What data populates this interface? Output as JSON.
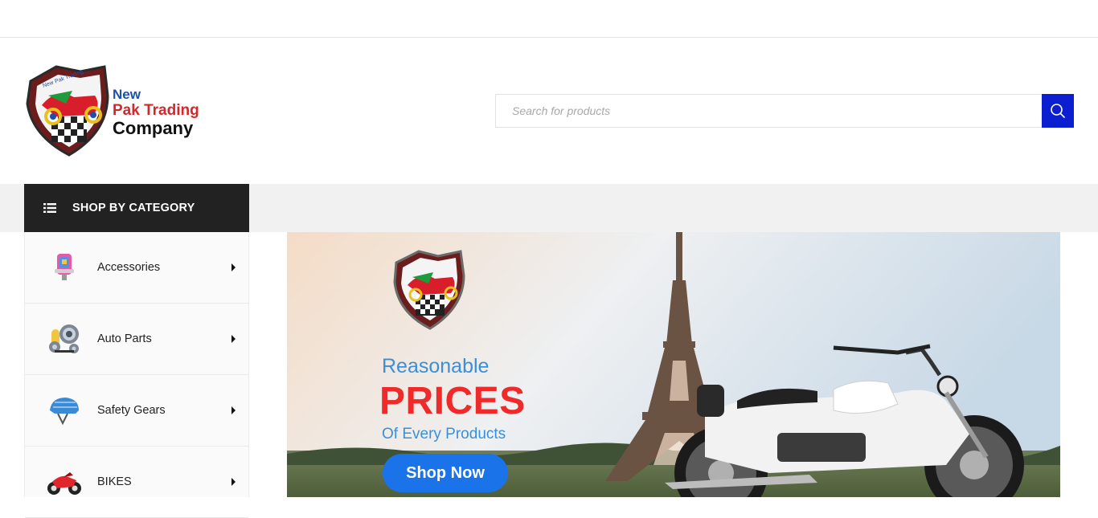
{
  "brand": {
    "line1": "New",
    "line2": "Pak Trading",
    "line3": "Company"
  },
  "search": {
    "placeholder": "Search for products",
    "button_icon": "search-icon"
  },
  "category_menu": {
    "title": "SHOP BY CATEGORY",
    "icon": "list-icon",
    "items": [
      {
        "label": "Accessories",
        "icon": "accessory-icon"
      },
      {
        "label": "Auto Parts",
        "icon": "gears-icon"
      },
      {
        "label": "Safety Gears",
        "icon": "helmet-icon"
      },
      {
        "label": "BIKES",
        "icon": "motorbike-icon"
      }
    ]
  },
  "banner": {
    "line1": "Reasonable",
    "line2": "PRICES",
    "line3": "Of Every Products",
    "cta": "Shop Now"
  },
  "colors": {
    "accent": "#0b1fd1",
    "category_header": "#222222",
    "cta": "#1a73e8",
    "prices": "#ee2a2a",
    "banner_text": "#3a8fd8"
  }
}
